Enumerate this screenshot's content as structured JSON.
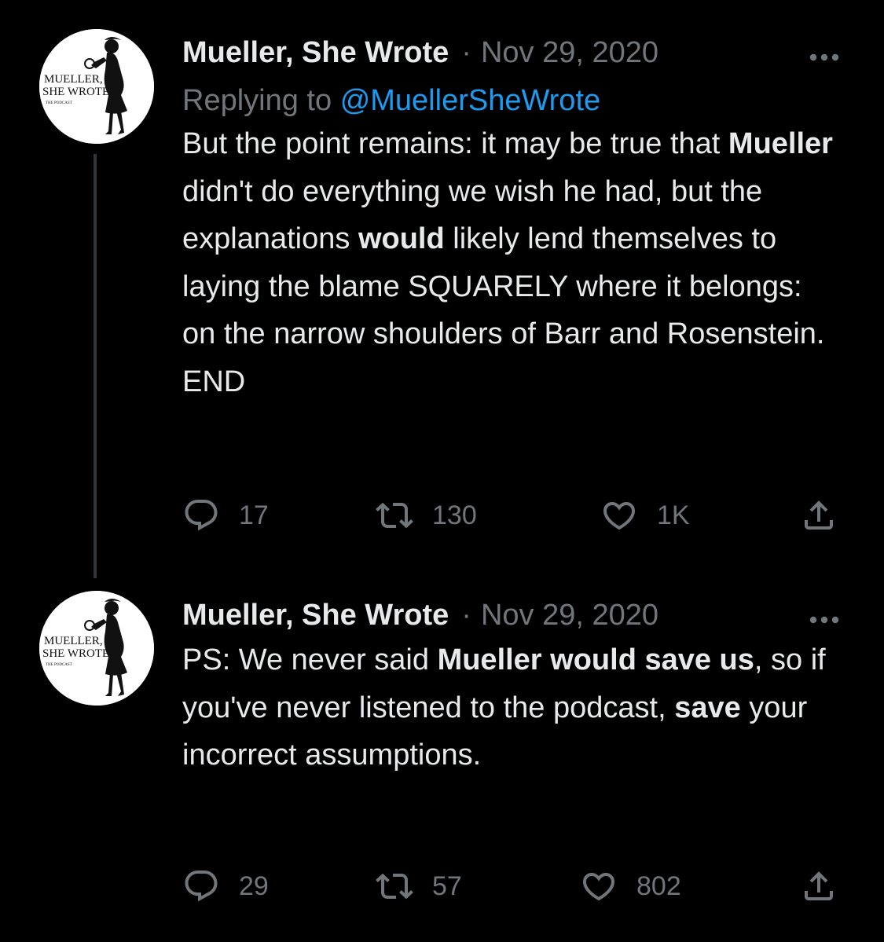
{
  "colors": {
    "background": "#000000",
    "text": "#e7e9ea",
    "muted": "#71767b",
    "link": "#1d9bf0",
    "thread_line": "#333639"
  },
  "avatar": {
    "line1": "MUELLER,",
    "line2": "SHE WROTE",
    "line3": "THE PODCAST"
  },
  "tweets": [
    {
      "author": "Mueller, She Wrote",
      "separator": "·",
      "date": "Nov 29, 2020",
      "replying_prefix": "Replying to",
      "replying_handle": "@MuellerSheWrote",
      "body": [
        {
          "text": "But the point remains: it may be true that ",
          "bold": false
        },
        {
          "text": "Mueller",
          "bold": true
        },
        {
          "text": " didn't do everything we wish he had, but the explanations ",
          "bold": false
        },
        {
          "text": "would",
          "bold": true
        },
        {
          "text": " likely lend themselves to laying the blame SQUARELY where it belongs: on the narrow shoulders of Barr and Rosenstein.",
          "bold": false
        },
        {
          "text": "END",
          "bold": false,
          "break_before": true
        }
      ],
      "replies": "17",
      "retweets": "130",
      "likes": "1K",
      "icons": [
        "reply-icon",
        "retweet-icon",
        "heart-icon",
        "share-icon"
      ]
    },
    {
      "author": "Mueller, She Wrote",
      "separator": "·",
      "date": "Nov 29, 2020",
      "body": [
        {
          "text": "PS: We never said ",
          "bold": false
        },
        {
          "text": "Mueller would save us",
          "bold": true
        },
        {
          "text": ", so if you've never listened to the podcast, ",
          "bold": false
        },
        {
          "text": "save",
          "bold": true
        },
        {
          "text": " your incorrect assumptions.",
          "bold": false
        }
      ],
      "replies": "29",
      "retweets": "57",
      "likes": "802",
      "icons": [
        "reply-icon",
        "retweet-icon",
        "heart-icon",
        "share-icon"
      ]
    }
  ]
}
